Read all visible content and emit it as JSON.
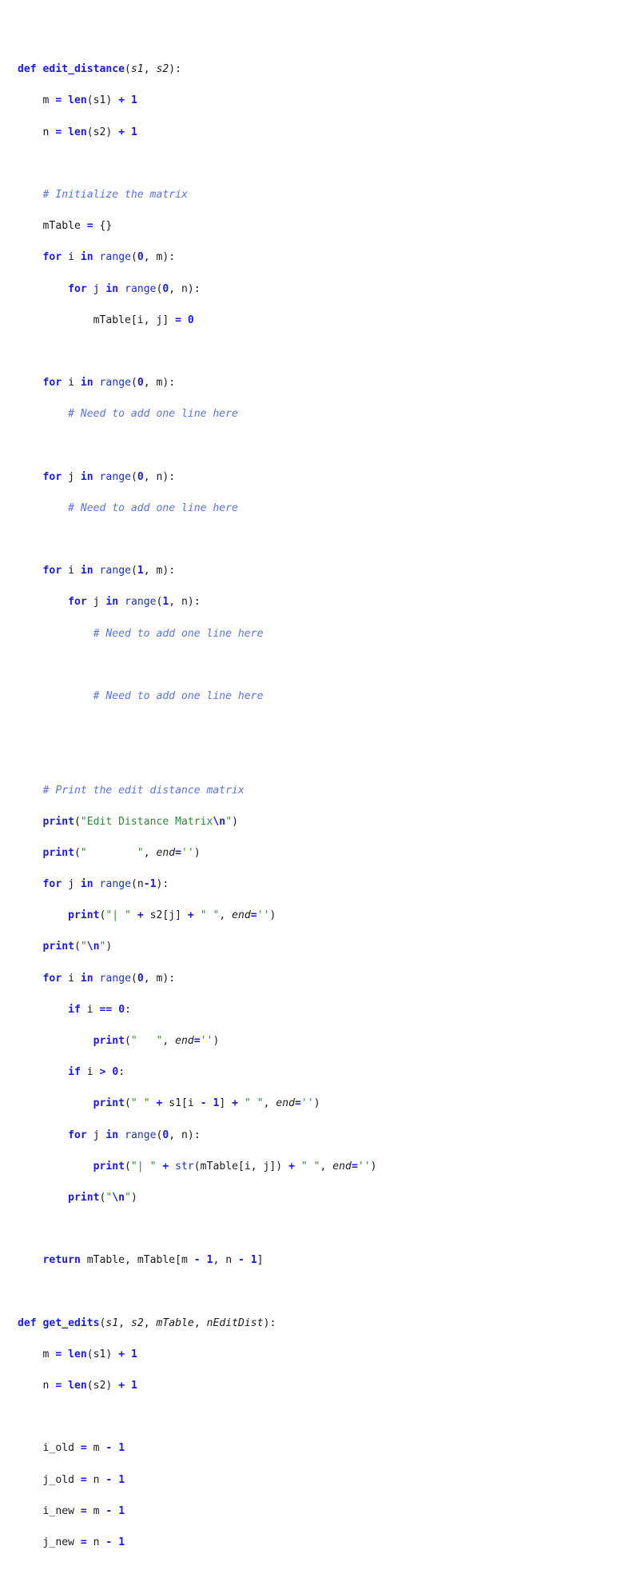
{
  "document": {
    "language": "python",
    "background_color": "#ffffff",
    "theme": {
      "keyword_color": "#1a1ae6",
      "builtin_color": "#1a35b8",
      "string_color": "#2e8b35",
      "comment_color": "#5a74e0",
      "number_color": "#1a1ae6",
      "operator_color": "#1a1ae6",
      "parameter_color": "#1a1a1a",
      "plain_color": "#1a1a1a"
    }
  },
  "code": {
    "lines": [
      "def edit_distance(s1, s2):",
      "    m = len(s1) + 1",
      "    n = len(s2) + 1",
      "",
      "    # Initialize the matrix",
      "    mTable = {}",
      "    for i in range(0, m):",
      "        for j in range(0, n):",
      "            mTable[i, j] = 0",
      "",
      "    for i in range(0, m):",
      "        # Need to add one line here",
      "",
      "    for j in range(0, n):",
      "        # Need to add one line here",
      "",
      "    for i in range(1, m):",
      "        for j in range(1, n):",
      "            # Need to add one line here",
      "",
      "            # Need to add one line here",
      "",
      "",
      "    # Print the edit distance matrix",
      "    print(\"Edit Distance Matrix\\n\")",
      "    print(\"        \", end='')",
      "    for j in range(n-1):",
      "        print(\"| \" + s2[j] + \" \", end='')",
      "    print(\"\\n\")",
      "    for i in range(0, m):",
      "        if i == 0:",
      "            print(\"   \", end='')",
      "        if i > 0:",
      "            print(\" \" + s1[i - 1] + \" \", end='')",
      "        for j in range(0, n):",
      "            print(\"| \" + str(mTable[i, j]) + \" \", end='')",
      "        print(\"\\n\")",
      "",
      "    return mTable, mTable[m - 1, n - 1]",
      "",
      "def get_edits(s1, s2, mTable, nEditDist):",
      "    m = len(s1) + 1",
      "    n = len(s2) + 1",
      "",
      "    i_old = m - 1",
      "    j_old = n - 1",
      "    i_new = m - 1",
      "    j_new = n - 1"
    ],
    "functions": [
      {
        "name": "edit_distance",
        "parameters": [
          "s1",
          "s2"
        ]
      },
      {
        "name": "get_edits",
        "parameters": [
          "s1",
          "s2",
          "mTable",
          "nEditDist"
        ]
      }
    ],
    "comments": [
      "# Initialize the matrix",
      "# Need to add one line here",
      "# Need to add one line here",
      "# Need to add one line here",
      "# Need to add one line here",
      "# Print the edit distance matrix"
    ],
    "strings": [
      "\"Edit Distance Matrix\\n\"",
      "\"        \"",
      "\"| \"",
      "\" \"",
      "\"\\n\"",
      "\"   \"",
      "\" \"",
      "\" \"",
      "\"| \"",
      "\" \"",
      "\"\\n\"",
      "''"
    ]
  }
}
